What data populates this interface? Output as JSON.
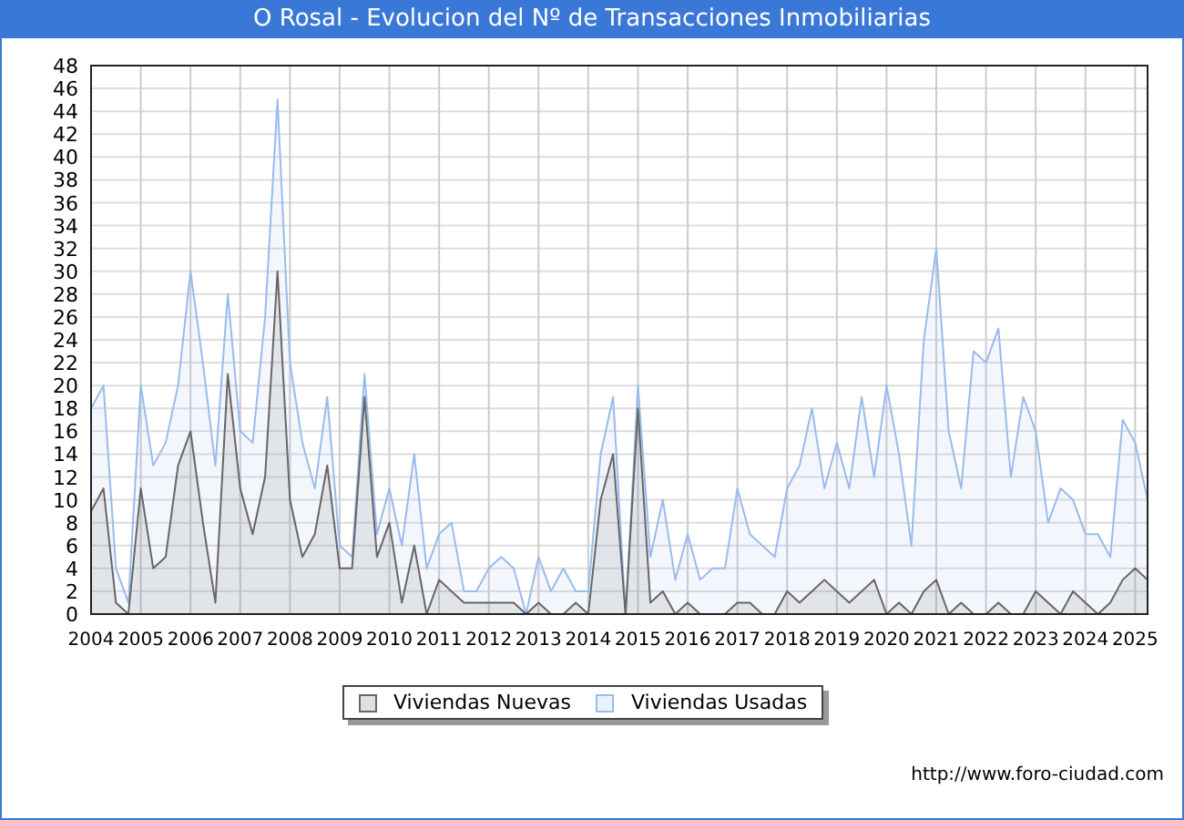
{
  "chart": {
    "chart_data": {
      "type": "area",
      "title": "O Rosal - Evolucion del Nº de Transacciones Inmobiliarias",
      "xlim": [
        2004,
        2025.25
      ],
      "ylim": [
        0,
        48
      ],
      "xticks": [
        2004,
        2005,
        2006,
        2007,
        2008,
        2009,
        2010,
        2011,
        2012,
        2013,
        2014,
        2015,
        2016,
        2017,
        2018,
        2019,
        2020,
        2021,
        2022,
        2023,
        2024,
        2025
      ],
      "yticks": [
        0,
        2,
        4,
        6,
        8,
        10,
        12,
        14,
        16,
        18,
        20,
        22,
        24,
        26,
        28,
        30,
        32,
        34,
        36,
        38,
        40,
        42,
        44,
        46,
        48
      ],
      "grid": true,
      "x": [
        2004,
        2004.25,
        2004.5,
        2004.75,
        2005,
        2005.25,
        2005.5,
        2005.75,
        2006,
        2006.25,
        2006.5,
        2006.75,
        2007,
        2007.25,
        2007.5,
        2007.75,
        2008,
        2008.25,
        2008.5,
        2008.75,
        2009,
        2009.25,
        2009.5,
        2009.75,
        2010,
        2010.25,
        2010.5,
        2010.75,
        2011,
        2011.25,
        2011.5,
        2011.75,
        2012,
        2012.25,
        2012.5,
        2012.75,
        2013,
        2013.25,
        2013.5,
        2013.75,
        2014,
        2014.25,
        2014.5,
        2014.75,
        2015,
        2015.25,
        2015.5,
        2015.75,
        2016,
        2016.25,
        2016.5,
        2016.75,
        2017,
        2017.25,
        2017.5,
        2017.75,
        2018,
        2018.25,
        2018.5,
        2018.75,
        2019,
        2019.25,
        2019.5,
        2019.75,
        2020,
        2020.25,
        2020.5,
        2020.75,
        2021,
        2021.25,
        2021.5,
        2021.75,
        2022,
        2022.25,
        2022.5,
        2022.75,
        2023,
        2023.25,
        2023.5,
        2023.75,
        2024,
        2024.25,
        2024.5,
        2024.75,
        2025,
        2025.25
      ],
      "series": [
        {
          "name": "Viviendas Nuevas",
          "color": "#666666",
          "values": [
            9,
            11,
            1,
            0,
            11,
            4,
            5,
            13,
            16,
            8,
            1,
            21,
            11,
            7,
            12,
            30,
            10,
            5,
            7,
            13,
            4,
            4,
            19,
            5,
            8,
            1,
            6,
            0,
            3,
            2,
            1,
            1,
            1,
            1,
            1,
            0,
            1,
            0,
            0,
            1,
            0,
            10,
            14,
            0,
            18,
            1,
            2,
            0,
            1,
            0,
            0,
            0,
            1,
            1,
            0,
            0,
            2,
            1,
            2,
            3,
            2,
            1,
            2,
            3,
            0,
            1,
            0,
            2,
            3,
            0,
            1,
            0,
            0,
            1,
            0,
            0,
            2,
            1,
            0,
            2,
            1,
            0,
            1,
            3,
            4,
            3
          ]
        },
        {
          "name": "Viviendas Usadas",
          "color": "#99bbee",
          "values": [
            18,
            20,
            4,
            1,
            20,
            13,
            15,
            20,
            30,
            22,
            13,
            28,
            16,
            15,
            26,
            45,
            22,
            15,
            11,
            19,
            6,
            5,
            21,
            7,
            11,
            6,
            14,
            4,
            7,
            8,
            2,
            2,
            4,
            5,
            4,
            0,
            5,
            2,
            4,
            2,
            2,
            14,
            19,
            0,
            20,
            5,
            10,
            3,
            7,
            3,
            4,
            4,
            11,
            7,
            6,
            5,
            11,
            13,
            18,
            11,
            15,
            11,
            19,
            12,
            20,
            14,
            6,
            24,
            32,
            16,
            11,
            23,
            22,
            25,
            12,
            19,
            16,
            8,
            11,
            10,
            7,
            7,
            5,
            17,
            15,
            10
          ]
        }
      ]
    }
  },
  "footer": {
    "url": "http://www.foro-ciudad.com"
  }
}
